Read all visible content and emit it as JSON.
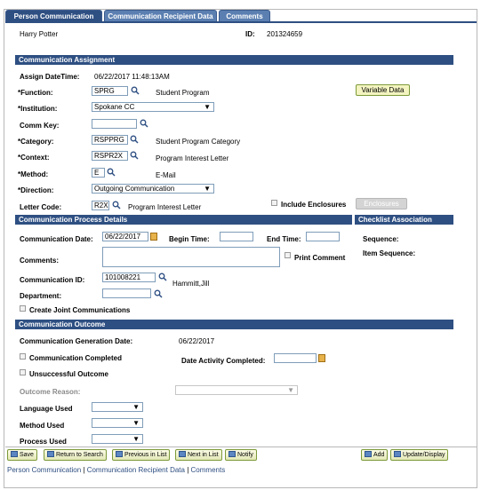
{
  "tabs": [
    "Person Communication",
    "Communication Recipient Data",
    "Comments"
  ],
  "header": {
    "name": "Harry Potter",
    "id_label": "ID:",
    "id_value": "201324659"
  },
  "sections": {
    "assignment": "Communication Assignment",
    "process": "Communication Process Details",
    "checklist": "Checklist Association",
    "outcome": "Communication Outcome"
  },
  "assignment": {
    "assign_datetime_label": "Assign DateTime:",
    "assign_datetime_value": "06/22/2017 11:48:13AM",
    "function_label": "*Function:",
    "function_value": "SPRG",
    "function_desc": "Student Program",
    "variable_data_button": "Variable Data",
    "institution_label": "*Institution:",
    "institution_value": "Spokane CC",
    "comm_key_label": "Comm Key:",
    "comm_key_value": "",
    "category_label": "*Category:",
    "category_value": "RSPPRG",
    "category_desc": "Student Program Category",
    "context_label": "*Context:",
    "context_value": "RSPR2X",
    "context_desc": "Program Interest Letter",
    "method_label": "*Method:",
    "method_value": "E",
    "method_desc": "E-Mail",
    "direction_label": "*Direction:",
    "direction_value": "Outgoing Communication",
    "letter_code_label": "Letter Code:",
    "letter_code_value": "R2X",
    "letter_code_desc": "Program Interest Letter",
    "include_enclosures_label": "Include Enclosures",
    "enclosures_button": "Enclosures"
  },
  "process": {
    "comm_date_label": "Communication Date:",
    "comm_date_value": "06/22/2017",
    "begin_time_label": "Begin Time:",
    "begin_time_value": "",
    "end_time_label": "End Time:",
    "end_time_value": "",
    "comments_label": "Comments:",
    "print_comment_label": "Print Comment",
    "comm_id_label": "Communication ID:",
    "comm_id_value": "101008221",
    "comm_id_desc": "Hammitt,Jill",
    "department_label": "Department:",
    "department_value": "",
    "joint_label": "Create Joint Communications"
  },
  "checklist": {
    "sequence_label": "Sequence:",
    "item_sequence_label": "Item Sequence:"
  },
  "outcome": {
    "generation_date_label": "Communication Generation Date:",
    "generation_date_value": "06/22/2017",
    "completed_label": "Communication Completed",
    "date_activity_label": "Date Activity Completed:",
    "date_activity_value": "",
    "unsuccessful_label": "Unsuccessful Outcome",
    "outcome_reason_label": "Outcome Reason:",
    "language_label": "Language Used",
    "method_used_label": "Method Used",
    "process_used_label": "Process Used"
  },
  "toolbar": {
    "save": "Save",
    "return_to_search": "Return to Search",
    "previous_in_list": "Previous in List",
    "next_in_list": "Next in List",
    "notify": "Notify",
    "add": "Add",
    "update_display": "Update/Display"
  },
  "footer_links": [
    "Person Communication",
    "Communication Recipient Data",
    "Comments"
  ],
  "footer_sep": "|",
  "icons": {
    "lookup": "magnifier-icon",
    "calendar": "calendar-icon",
    "dropdown": "dropdown-arrow-icon"
  },
  "colors": {
    "section_bg": "#2e4f82",
    "tab_active": "#2e4f82",
    "tab_inactive": "#5b7fb1",
    "button_bg": "#e2e7b5",
    "calendar": "#e8b24b"
  }
}
